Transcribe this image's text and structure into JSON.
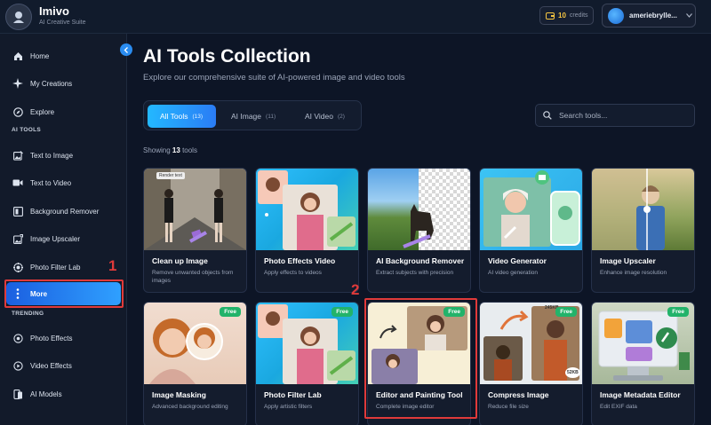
{
  "app": {
    "name": "Imivo",
    "subtitle": "AI Creative Suite"
  },
  "topbar": {
    "credits_value": "10",
    "credits_label": "credits",
    "username": "ameriebrylle..."
  },
  "sidebar": {
    "items": [
      {
        "label": "Home",
        "icon": "home-icon"
      },
      {
        "label": "My Creations",
        "icon": "sparkle-icon"
      },
      {
        "label": "Explore",
        "icon": "compass-icon"
      }
    ],
    "ai_tools_label": "AI TOOLS",
    "tools": [
      {
        "label": "Text to Image",
        "icon": "image-edit-icon"
      },
      {
        "label": "Text to Video",
        "icon": "video-icon"
      },
      {
        "label": "Background Remover",
        "icon": "layers-icon"
      },
      {
        "label": "Image Upscaler",
        "icon": "upscale-icon"
      },
      {
        "label": "Photo Filter Lab",
        "icon": "filter-icon"
      },
      {
        "label": "More",
        "icon": "more-dots-icon",
        "active": true
      }
    ],
    "trending_label": "TRENDING",
    "trending": [
      {
        "label": "Photo Effects",
        "icon": "effects-icon"
      },
      {
        "label": "Video Effects",
        "icon": "video-effects-icon"
      },
      {
        "label": "AI Models",
        "icon": "model-icon"
      }
    ]
  },
  "annotations": {
    "marker_1": "1",
    "marker_2": "2"
  },
  "main": {
    "title": "AI Tools Collection",
    "subtitle": "Explore our comprehensive suite of AI-powered image and video tools",
    "tabs": [
      {
        "label": "All Tools",
        "count": "(13)",
        "active": true
      },
      {
        "label": "AI Image",
        "count": "(11)"
      },
      {
        "label": "AI Video",
        "count": "(2)"
      }
    ],
    "search_placeholder": "Search tools...",
    "showing_prefix": "Showing",
    "showing_count": "13",
    "showing_suffix": "tools",
    "cards": [
      {
        "title": "Clean up Image",
        "desc": "Remove unwanted objects from images",
        "badge": "",
        "thumb_tag": "Render text"
      },
      {
        "title": "Photo Effects Video",
        "desc": "Apply effects to videos",
        "badge": ""
      },
      {
        "title": "AI Background Remover",
        "desc": "Extract subjects with precision",
        "badge": ""
      },
      {
        "title": "Video Generator",
        "desc": "AI video generation",
        "badge": ""
      },
      {
        "title": "Image Upscaler",
        "desc": "Enhance image resolution",
        "badge": ""
      },
      {
        "title": "Image Masking",
        "desc": "Advanced background editing",
        "badge": "Free"
      },
      {
        "title": "Photo Filter Lab",
        "desc": "Apply artistic filters",
        "badge": "Free"
      },
      {
        "title": "Editor and Painting Tool",
        "desc": "Complete image editor",
        "badge": "Free"
      },
      {
        "title": "Compress Image",
        "desc": "Reduce file size",
        "badge": "Free",
        "thumb_tags": [
          "245KB",
          "52KB"
        ]
      },
      {
        "title": "Image Metadata Editor",
        "desc": "Edit EXIF data",
        "badge": "Free"
      }
    ]
  },
  "colors": {
    "accent": "#2a8cf0",
    "active_nav": "#1b5fe0",
    "free_badge": "#22b36a",
    "highlight_box": "#e03a3a"
  }
}
